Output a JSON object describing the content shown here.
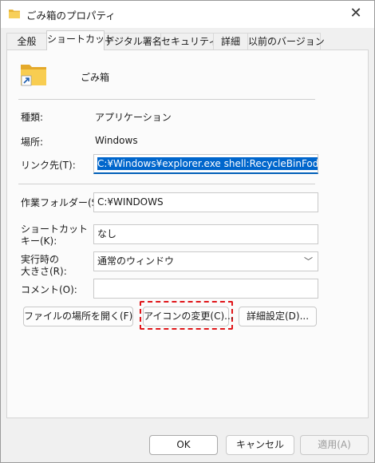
{
  "window": {
    "title": "ごみ箱のプロパティ",
    "close": "✕"
  },
  "tabs": [
    {
      "label": "全般"
    },
    {
      "label": "ショートカット"
    },
    {
      "label": "デジタル署名"
    },
    {
      "label": "セキュリティ"
    },
    {
      "label": "詳細"
    },
    {
      "label": "以前のバージョン"
    }
  ],
  "header": {
    "name": "ごみ箱"
  },
  "info": {
    "type_label": "種類:",
    "type_value": "アプリケーション",
    "location_label": "場所:",
    "location_value": "Windows"
  },
  "link": {
    "label": "リンク先(T):",
    "value": "C:¥Windows¥explorer.exe shell:RecycleBinFoder"
  },
  "workdir": {
    "label": "作業フォルダー(S):",
    "value": "C:¥WINDOWS"
  },
  "shortcut_key": {
    "label_1": "ショートカット",
    "label_2": "キー(K):",
    "value": "なし"
  },
  "run": {
    "label_1": "実行時の",
    "label_2": "大きさ(R):",
    "value": "通常のウィンドウ"
  },
  "comment": {
    "label": "コメント(O):",
    "value": ""
  },
  "actions": {
    "open_location": "ファイルの場所を開く(F)",
    "change_icon": "アイコンの変更(C)...",
    "advanced": "詳細設定(D)..."
  },
  "footer": {
    "ok": "OK",
    "cancel": "キャンセル",
    "apply": "適用(A)"
  },
  "icons": {
    "folder": "folder-shortcut-icon",
    "app": "folder-icon"
  },
  "colors": {
    "accent": "#005fb8",
    "highlight": "#e0161a",
    "selection": "#0066cc"
  }
}
